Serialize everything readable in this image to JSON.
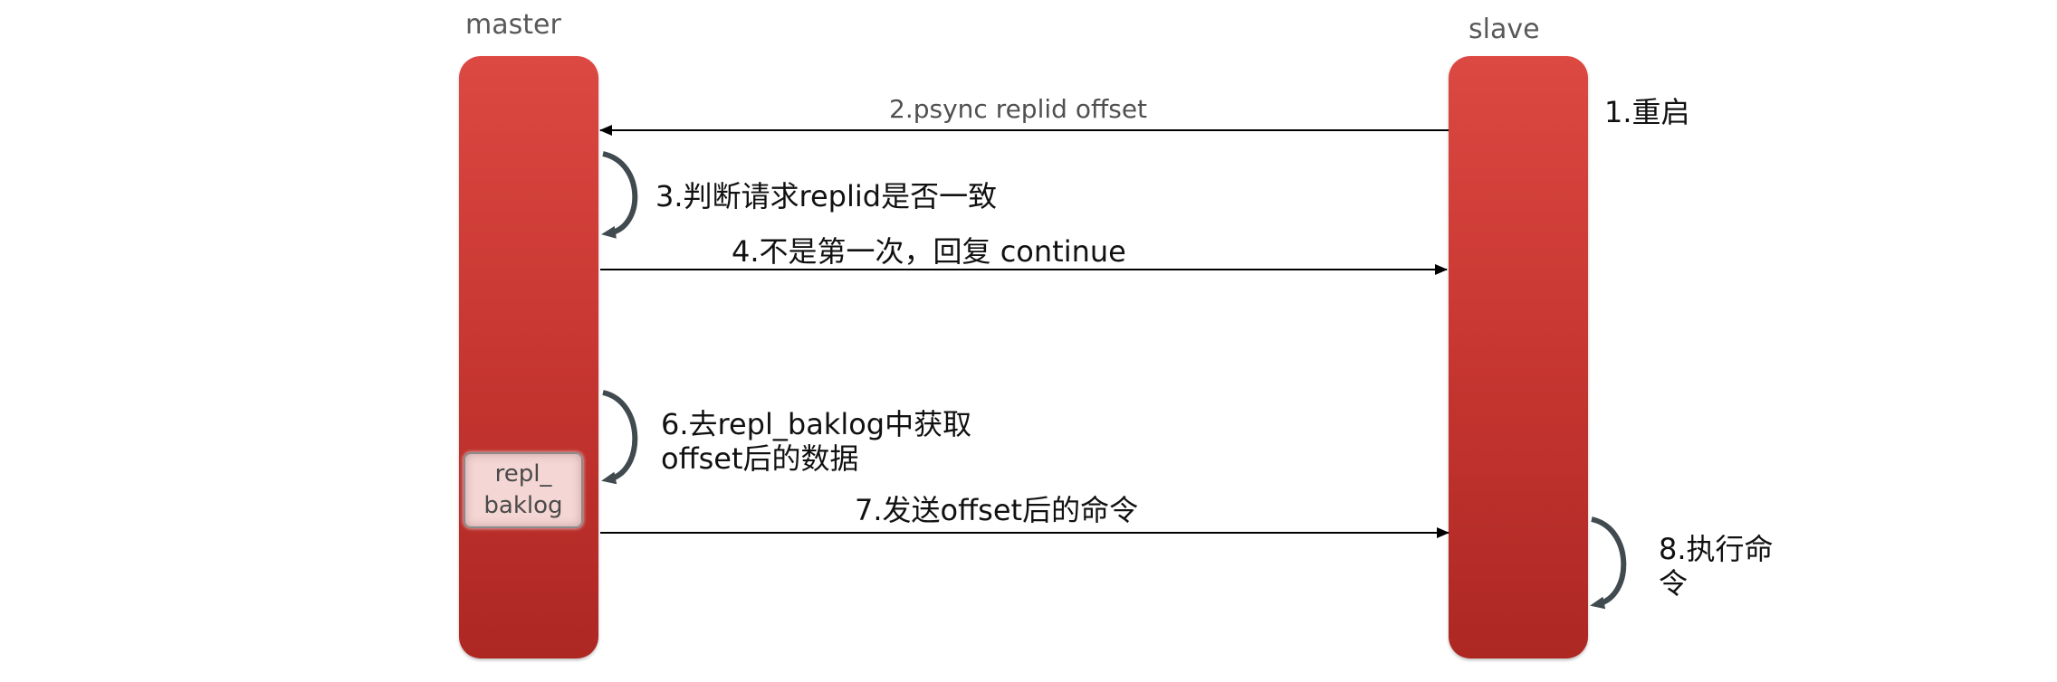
{
  "lanes": {
    "master": {
      "title": "master",
      "color_top": "#dc4842",
      "color_bottom": "#ad2723"
    },
    "slave": {
      "title": "slave",
      "color_top": "#dc4842",
      "color_bottom": "#ad2723"
    }
  },
  "buffer": {
    "line1": "repl_",
    "line2": "baklog"
  },
  "steps": {
    "s1": "1.重启",
    "s2": "2.psync replid offset",
    "s3": "3.判断请求replid是否一致",
    "s4": "4.不是第一次，回复 continue",
    "s6_line1": "6.去repl_baklog中获取",
    "s6_line2": "offset后的数据",
    "s7": "7.发送offset后的命令",
    "s8_line1": "8.执行命",
    "s8_line2": "令"
  },
  "colors": {
    "lane": "#c73631",
    "arrow": "#000000",
    "loop_arrow": "#404a4f",
    "buffer_fill": "#f4d6d4"
  }
}
